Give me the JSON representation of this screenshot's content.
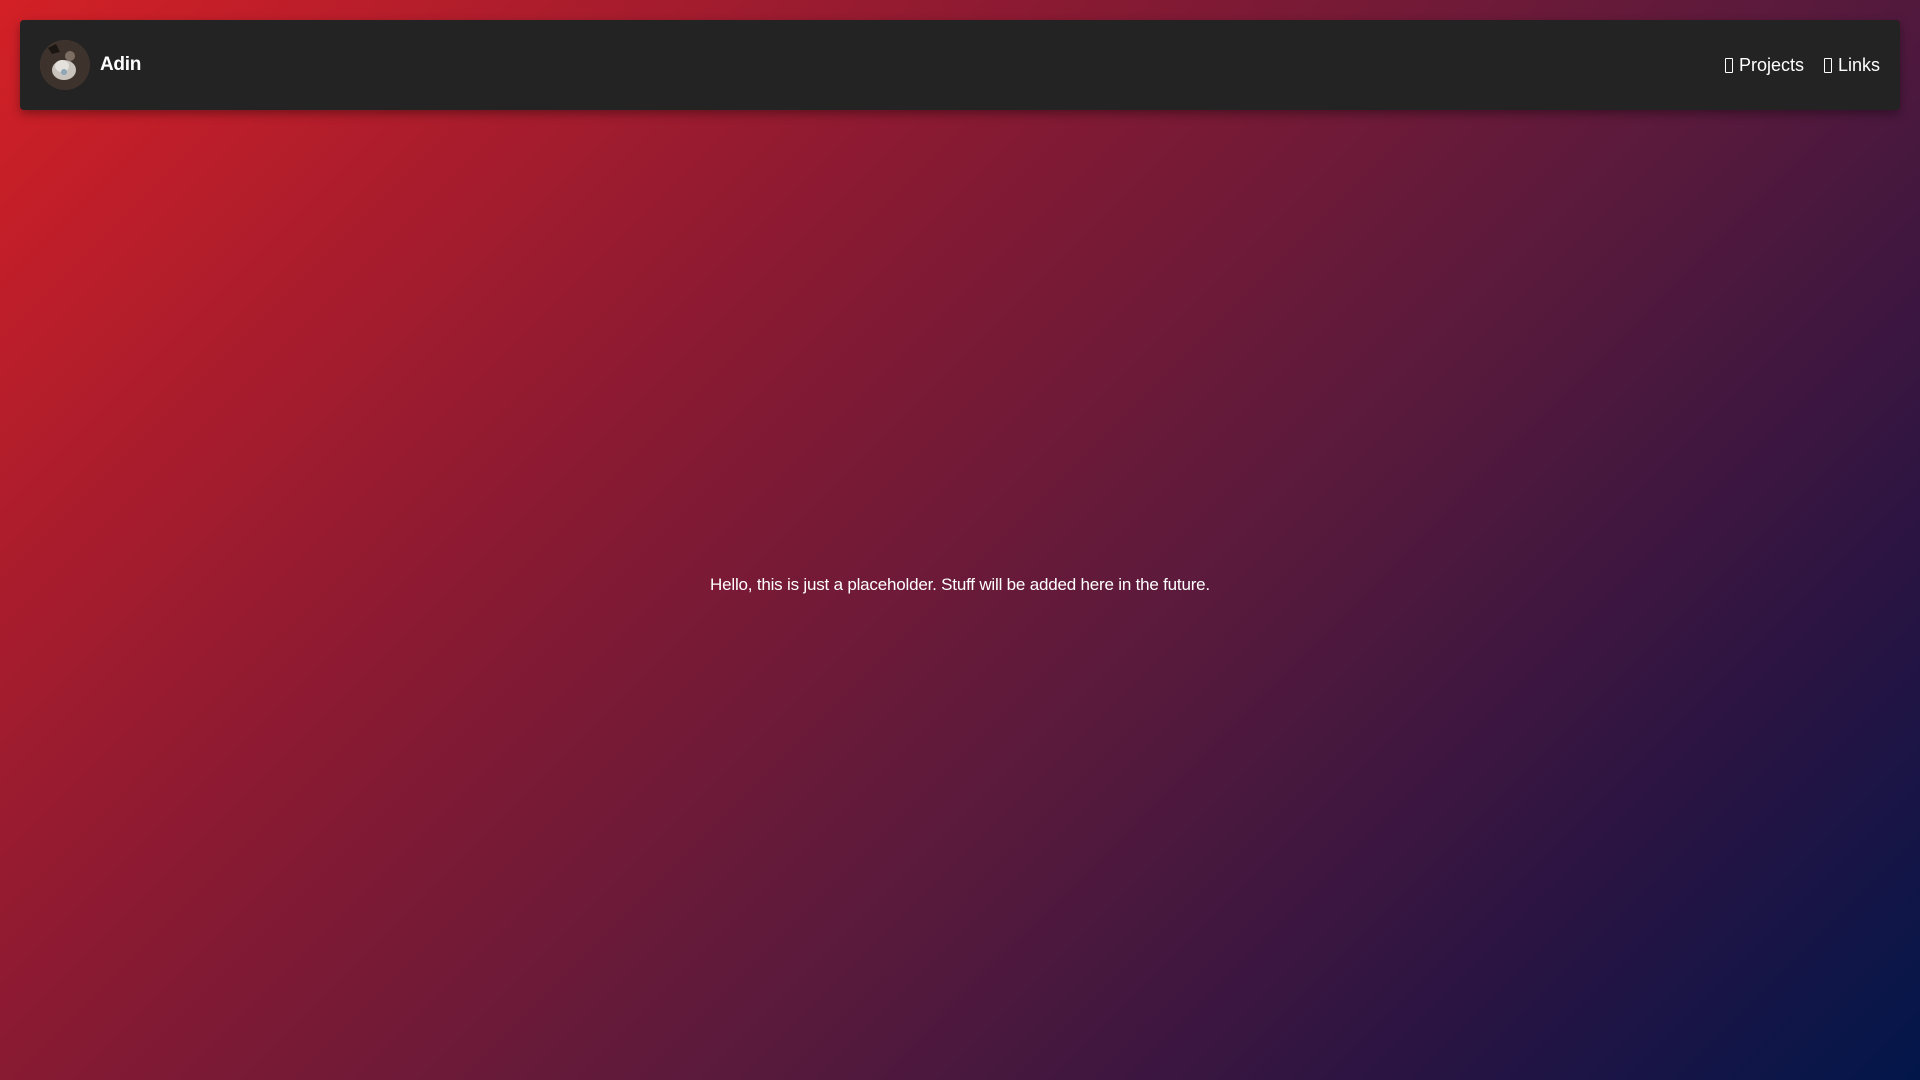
{
  "navbar": {
    "brand_name": "Adin",
    "links": [
      {
        "label": "Projects",
        "icon": "projects-icon"
      },
      {
        "label": "Links",
        "icon": "links-icon"
      }
    ]
  },
  "main": {
    "placeholder_text": "Hello, this is just a placeholder. Stuff will be added here in the future."
  },
  "colors": {
    "navbar_bg": "#232323",
    "gradient_start": "#d32026",
    "gradient_end": "#02164a",
    "text": "#ffffff"
  }
}
